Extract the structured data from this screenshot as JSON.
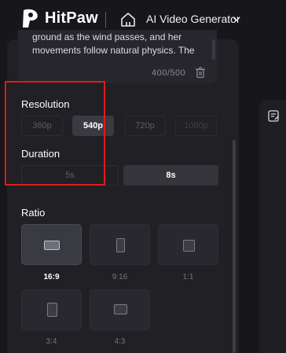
{
  "header": {
    "brand": "HitPaw",
    "product": "AI Video Generator"
  },
  "prompt": {
    "text": "ground as the wind passes, and her movements follow natural physics. The",
    "counter": "400/500"
  },
  "resolution": {
    "label": "Resolution",
    "options": [
      "360p",
      "540p",
      "720p",
      "1080p"
    ],
    "selected": "540p",
    "disabled": [
      "1080p"
    ]
  },
  "duration": {
    "label": "Duration",
    "options": [
      "5s",
      "8s"
    ],
    "selected": "8s"
  },
  "ratio": {
    "label": "Ratio",
    "options": [
      "16:9",
      "9:16",
      "1:1",
      "3:4",
      "4:3"
    ],
    "selected": "16:9"
  },
  "colors": {
    "background": "#17171b",
    "panel": "#202025",
    "highlight": "#e01b1b"
  },
  "icons": [
    "hitpaw-logo-icon",
    "home-icon",
    "chevron-down-icon",
    "trash-icon",
    "notes-icon"
  ]
}
